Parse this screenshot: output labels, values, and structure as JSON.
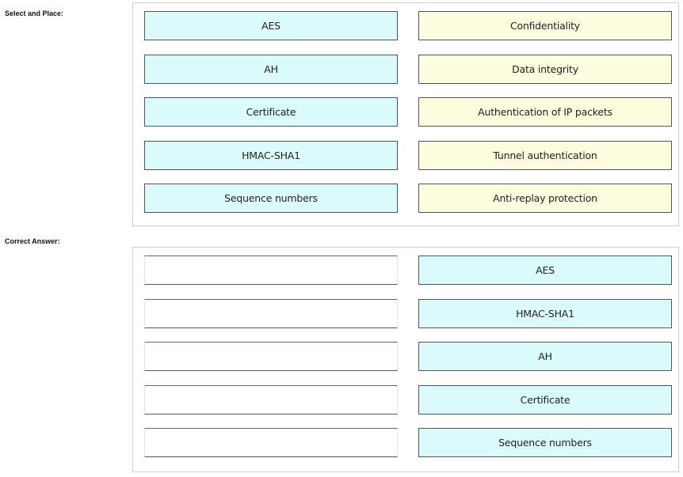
{
  "select_and_place": {
    "label": "Select and Place:",
    "left_items": [
      "AES",
      "AH",
      "Certificate",
      "HMAC-SHA1",
      "Sequence numbers"
    ],
    "right_targets": [
      "Confidentiality",
      "Data integrity",
      "Authentication of IP packets",
      "Tunnel authentication",
      "Anti-replay protection"
    ]
  },
  "correct_answer": {
    "label": "Correct Answer:",
    "left_slots": [
      "",
      "",
      "",
      "",
      ""
    ],
    "right_items": [
      "AES",
      "HMAC-SHA1",
      "AH",
      "Certificate",
      "Sequence numbers"
    ]
  },
  "colors": {
    "technology_box": "#dbfafc",
    "function_box": "#fdfde0"
  }
}
